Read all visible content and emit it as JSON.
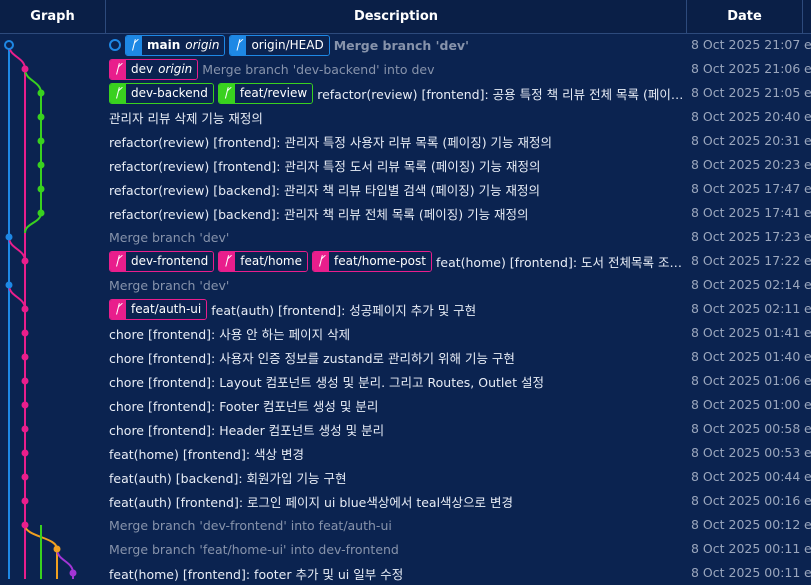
{
  "header": {
    "graph": "Graph",
    "description": "Description",
    "date": "Date"
  },
  "colors": {
    "blue": "#1e88e5",
    "magenta": "#e91e8c",
    "green": "#39d11f",
    "orange": "#f0a020",
    "purple": "#a335d6"
  },
  "commits": [
    {
      "refs": [
        {
          "name": "main",
          "origin": "origin",
          "color": "blue",
          "head": true
        },
        {
          "name": "origin/HEAD",
          "color": "blue"
        }
      ],
      "message": "Merge branch 'dev'",
      "style": "dimbold",
      "date": "8 Oct 2025 21:07",
      "extra": "e"
    },
    {
      "refs": [
        {
          "name": "dev",
          "origin": "origin",
          "color": "magenta"
        }
      ],
      "message": "Merge branch 'dev-backend' into dev",
      "style": "dim",
      "date": "8 Oct 2025 21:06",
      "extra": "e"
    },
    {
      "refs": [
        {
          "name": "dev-backend",
          "color": "green"
        },
        {
          "name": "feat/review",
          "color": "green"
        }
      ],
      "message": "refactor(review) [frontend]: 공용 특정 책 리뷰 전체 목록 (페이징) 기능 재정의",
      "style": "normal",
      "date": "8 Oct 2025 21:05",
      "extra": "e"
    },
    {
      "refs": [],
      "message": "관리자 리뷰 삭제 기능 재정의",
      "style": "normal",
      "date": "8 Oct 2025 20:40",
      "extra": "e"
    },
    {
      "refs": [],
      "message": "refactor(review) [frontend]: 관리자 특정 사용자 리뷰 목록 (페이징) 기능 재정의",
      "style": "normal",
      "date": "8 Oct 2025 20:31",
      "extra": "e"
    },
    {
      "refs": [],
      "message": "refactor(review) [frontend]: 관리자 특정 도서 리뷰 목록 (페이징) 기능 재정의",
      "style": "normal",
      "date": "8 Oct 2025 20:23",
      "extra": "e"
    },
    {
      "refs": [],
      "message": "refactor(review) [backend]: 관리자 책 리뷰 타입별 검색 (페이징) 기능 재정의",
      "style": "normal",
      "date": "8 Oct 2025 17:47",
      "extra": "e"
    },
    {
      "refs": [],
      "message": "refactor(review) [backend]: 관리자 책 리뷰 전체 목록 (페이징) 기능 재정의",
      "style": "normal",
      "date": "8 Oct 2025 17:41",
      "extra": "e"
    },
    {
      "refs": [],
      "message": "Merge branch 'dev'",
      "style": "dim",
      "date": "8 Oct 2025 17:23",
      "extra": "e"
    },
    {
      "refs": [
        {
          "name": "dev-frontend",
          "color": "magenta"
        },
        {
          "name": "feat/home",
          "color": "magenta"
        },
        {
          "name": "feat/home-post",
          "color": "magenta"
        }
      ],
      "message": "feat(home) [frontend]: 도서 전체목록 조회 후...",
      "style": "normal",
      "date": "8 Oct 2025 17:22",
      "extra": "e"
    },
    {
      "refs": [],
      "message": "Merge branch 'dev'",
      "style": "dim",
      "date": "8 Oct 2025 02:14",
      "extra": "e"
    },
    {
      "refs": [
        {
          "name": "feat/auth-ui",
          "color": "magenta"
        }
      ],
      "message": "feat(auth) [frontend]: 성공페이지 추가 및 구현",
      "style": "normal",
      "date": "8 Oct 2025 02:11",
      "extra": "e"
    },
    {
      "refs": [],
      "message": "chore [frontend]: 사용 안 하는 페이지 삭제",
      "style": "normal",
      "date": "8 Oct 2025 01:41",
      "extra": "e"
    },
    {
      "refs": [],
      "message": "chore [frontend]: 사용자 인증 정보를 zustand로 관리하기 위해 기능 구현",
      "style": "normal",
      "date": "8 Oct 2025 01:40",
      "extra": "e"
    },
    {
      "refs": [],
      "message": "chore [frontend]: Layout 컴포넌트 생성 및 분리. 그리고 Routes, Outlet 설정",
      "style": "normal",
      "date": "8 Oct 2025 01:06",
      "extra": "e"
    },
    {
      "refs": [],
      "message": "chore [frontend]: Footer 컴포넌트 생성 및 분리",
      "style": "normal",
      "date": "8 Oct 2025 01:00",
      "extra": "e"
    },
    {
      "refs": [],
      "message": "chore [frontend]: Header 컴포넌트 생성 및 분리",
      "style": "normal",
      "date": "8 Oct 2025 00:58",
      "extra": "e"
    },
    {
      "refs": [],
      "message": "feat(home) [frontend]: 색상 변경",
      "style": "normal",
      "date": "8 Oct 2025 00:53",
      "extra": "e"
    },
    {
      "refs": [],
      "message": "feat(auth) [backend]: 회원가입 기능 구현",
      "style": "normal",
      "date": "8 Oct 2025 00:44",
      "extra": "e"
    },
    {
      "refs": [],
      "message": "feat(auth) [frontend]: 로그인 페이지 ui blue색상에서 teal색상으로 변경",
      "style": "normal",
      "date": "8 Oct 2025 00:16",
      "extra": "e"
    },
    {
      "refs": [],
      "message": "Merge branch 'dev-frontend' into feat/auth-ui",
      "style": "dim",
      "date": "8 Oct 2025 00:12",
      "extra": "e"
    },
    {
      "refs": [],
      "message": "Merge branch 'feat/home-ui' into dev-frontend",
      "style": "dim",
      "date": "8 Oct 2025 00:11",
      "extra": "e"
    },
    {
      "refs": [],
      "message": "feat(home) [frontend]: footer 추가 및 ui 일부 수정",
      "style": "normal",
      "date": "8 Oct 2025 00:11",
      "extra": "e"
    }
  ]
}
